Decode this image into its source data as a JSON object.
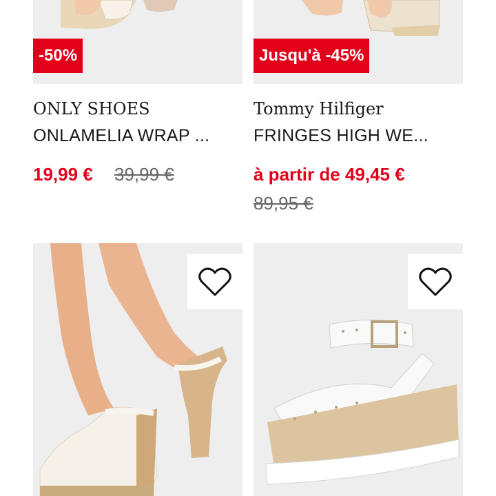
{
  "products": [
    {
      "brand": "ONLY SHOES",
      "name": "ONLAMELIA WRAP ...",
      "badge": "-50%",
      "price": "19,99 €",
      "old_price": "39,99 €"
    },
    {
      "brand": "Tommy Hilfiger",
      "name": "FRINGES HIGH WE...",
      "badge": "Jusqu'à -45%",
      "price": "à partir de 49,45 €",
      "old_price": "89,95 €"
    }
  ],
  "colors": {
    "accent": "#e3001b",
    "image_bg": "#eeeeee",
    "text": "#1a1a1a",
    "old_price": "#666666"
  },
  "icons": {
    "favorite": "heart-outline-icon"
  }
}
